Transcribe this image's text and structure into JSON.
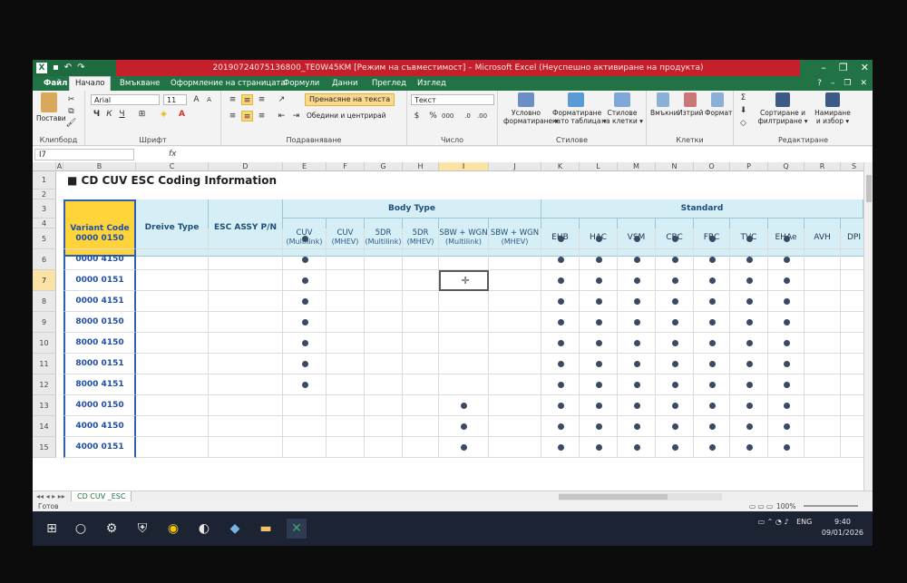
{
  "window": {
    "caption": "20190724075136800_TE0W45KM  [Режим на съвместимост] – Microsoft Excel (Неуспешно активиране на продукта)",
    "qat_undo": "↶",
    "qat_redo": "↷",
    "win_min": "–",
    "win_restore": "❐",
    "win_close": "✕"
  },
  "tabs": {
    "file": "Файл",
    "home": "Начало",
    "insert": "Вмъкване",
    "page_layout": "Оформление на страницата",
    "formulas": "Формули",
    "data": "Данни",
    "review": "Преглед",
    "view": "Изглед"
  },
  "ribbon": {
    "paste": "Постави",
    "clipboard": "Клипборд",
    "font_name": "Arial",
    "font_size": "11",
    "font_group": "Шрифт",
    "bold": "Ч",
    "italic": "К",
    "underline": "Ч",
    "wrap_text": "Пренасяне на текста",
    "merge_center": "Обедини и центрирай",
    "alignment_group": "Подравняване",
    "number_format": "Текст",
    "number_group": "Число",
    "cond_format_1": "Условно",
    "cond_format_2": "форматиране ▾",
    "format_table_1": "Форматиране",
    "format_table_2": "като таблица ▾",
    "cell_styles_1": "Стилове",
    "cell_styles_2": "на клетки ▾",
    "styles_group": "Стилове",
    "insert_cells": "Вмъкни",
    "delete_cells": "Изтрий",
    "format_cells": "Формат",
    "cells_group": "Клетки",
    "sort_filter_1": "Сортиране и",
    "sort_filter_2": "филтриране ▾",
    "find_select_1": "Намиране",
    "find_select_2": "и избор ▾",
    "editing_group": "Редактиране"
  },
  "formula_bar": {
    "name_box": "I7",
    "fx": "fx",
    "value": ""
  },
  "columns": [
    "A",
    "B",
    "C",
    "D",
    "E",
    "F",
    "G",
    "H",
    "I",
    "J",
    "K",
    "L",
    "M",
    "N",
    "O",
    "P",
    "Q",
    "R",
    "S"
  ],
  "row_numbers": [
    "1",
    "2",
    "3",
    "4",
    "5",
    "6",
    "7",
    "8",
    "9",
    "10",
    "11",
    "12",
    "13",
    "14",
    "15"
  ],
  "sheet": {
    "title": "■ CD CUV ESC Coding Information",
    "headers": {
      "variant_code": "Variant Code",
      "drive_type": "Dreive Type",
      "esc_assy": "ESC ASSY P/N",
      "body_type": "Body Type",
      "standard": "Standard"
    },
    "body_cols": [
      {
        "line1": "CUV",
        "line2": "(Multilink)"
      },
      {
        "line1": "CUV",
        "line2": "(MHEV)"
      },
      {
        "line1": "5DR",
        "line2": "(Multilink)"
      },
      {
        "line1": "5DR",
        "line2": "(MHEV)"
      },
      {
        "line1": "SBW + WGN",
        "line2": "(Multilink)"
      },
      {
        "line1": "SBW + WGN",
        "line2": "(MHEV)"
      }
    ],
    "std_cols": [
      "EHB",
      "HAC",
      "VSM",
      "CBC",
      "FBC",
      "TVC",
      "EHAe",
      "AVH",
      "DPI"
    ],
    "variants": [
      "0000 0150",
      "0000 4150",
      "0000 0151",
      "0000 4151",
      "8000 0150",
      "8000 4150",
      "8000 0151",
      "8000 4151",
      "4000 0150",
      "4000 4150",
      "4000 0151"
    ],
    "body_marks": [
      [
        1,
        0,
        0,
        0,
        0,
        0
      ],
      [
        1,
        0,
        0,
        0,
        0,
        0
      ],
      [
        1,
        0,
        0,
        0,
        0,
        0
      ],
      [
        1,
        0,
        0,
        0,
        0,
        0
      ],
      [
        1,
        0,
        0,
        0,
        0,
        0
      ],
      [
        1,
        0,
        0,
        0,
        0,
        0
      ],
      [
        1,
        0,
        0,
        0,
        0,
        0
      ],
      [
        1,
        0,
        0,
        0,
        0,
        0
      ],
      [
        0,
        0,
        0,
        0,
        1,
        0
      ],
      [
        0,
        0,
        0,
        0,
        1,
        0
      ],
      [
        0,
        0,
        0,
        0,
        1,
        0
      ]
    ],
    "std_marks": [
      [
        1,
        1,
        1,
        1,
        1,
        1,
        1,
        0,
        0
      ],
      [
        1,
        1,
        1,
        1,
        1,
        1,
        1,
        0,
        0
      ],
      [
        1,
        1,
        1,
        1,
        1,
        1,
        1,
        0,
        0
      ],
      [
        1,
        1,
        1,
        1,
        1,
        1,
        1,
        0,
        0
      ],
      [
        1,
        1,
        1,
        1,
        1,
        1,
        1,
        0,
        0
      ],
      [
        1,
        1,
        1,
        1,
        1,
        1,
        1,
        0,
        0
      ],
      [
        1,
        1,
        1,
        1,
        1,
        1,
        1,
        0,
        0
      ],
      [
        1,
        1,
        1,
        1,
        1,
        1,
        1,
        0,
        0
      ],
      [
        1,
        1,
        1,
        1,
        1,
        1,
        1,
        0,
        0
      ],
      [
        1,
        1,
        1,
        1,
        1,
        1,
        1,
        0,
        0
      ],
      [
        1,
        1,
        1,
        1,
        1,
        1,
        1,
        0,
        0
      ]
    ]
  },
  "sheet_tab": "CD CUV _ESC",
  "status": {
    "ready": "Готов",
    "zoom": "100%"
  },
  "taskbar": {
    "lang": "ENG",
    "time": "9:40",
    "date": "09/01/2026"
  }
}
